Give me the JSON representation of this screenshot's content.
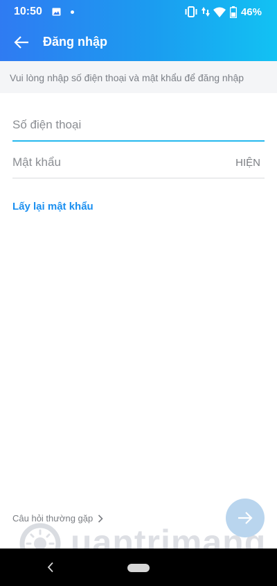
{
  "status_bar": {
    "time": "10:50",
    "battery": "46%",
    "icons": [
      "photo-icon",
      "dot-icon",
      "vibrate-icon",
      "data-arrows-icon",
      "wifi-icon",
      "battery-icon"
    ]
  },
  "app_bar": {
    "title": "Đăng nhập",
    "back_icon": "arrow-left-icon"
  },
  "hint": "Vui lòng nhập số điện thoại và mật khẩu để đăng nhập",
  "form": {
    "phone": {
      "value": "",
      "placeholder": "Số điện thoại"
    },
    "password": {
      "value": "",
      "placeholder": "Mật khẩu",
      "show_label": "HIỆN"
    },
    "recover_link": "Lấy lại mật khẩu"
  },
  "footer": {
    "faq_link": "Câu hỏi thường gặp",
    "next_icon": "arrow-right-icon"
  },
  "watermark": {
    "text": "uantrimang"
  },
  "colors": {
    "header_start": "#2f7bf2",
    "header_end": "#12c2f3",
    "accent": "#1a8ff0",
    "focus_line": "#24b8ee",
    "next_button": "#b9d5ee"
  }
}
